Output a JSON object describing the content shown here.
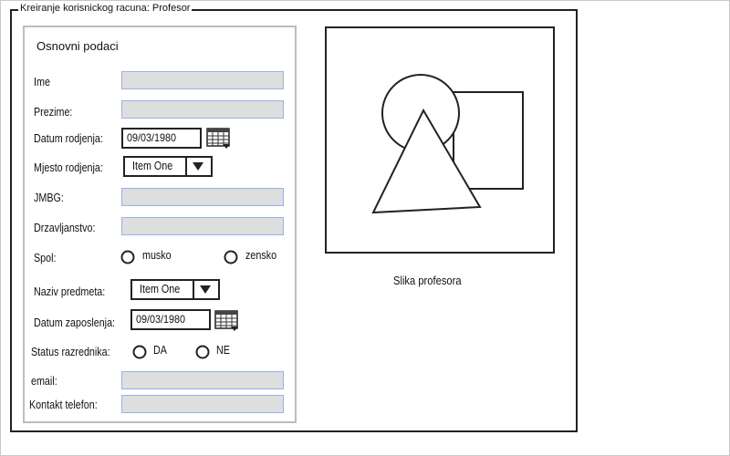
{
  "window": {
    "title": "Kreiranje korisnickog racuna: Profesor"
  },
  "panel": {
    "title": "Osnovni podaci"
  },
  "fields": {
    "ime": {
      "label": "Ime",
      "value": ""
    },
    "prezime": {
      "label": "Prezime:",
      "value": ""
    },
    "datum_rodjenja": {
      "label": "Datum rodjenja:",
      "value": "09/03/1980"
    },
    "mjesto_rodjenja": {
      "label": "Mjesto rodjenja:",
      "selected": "Item One"
    },
    "jmbg": {
      "label": "JMBG:",
      "value": ""
    },
    "drzavljanstvo": {
      "label": "Drzavljanstvo:",
      "value": ""
    },
    "spol": {
      "label": "Spol:",
      "options": [
        "musko",
        "zensko"
      ],
      "selected": null
    },
    "naziv_predmeta": {
      "label": "Naziv predmeta:",
      "selected": "Item One"
    },
    "datum_zaposlenja": {
      "label": "Datum zaposlenja:",
      "value": "09/03/1980"
    },
    "status_razrednika": {
      "label": "Status razrednika:",
      "options": [
        "DA",
        "NE"
      ],
      "selected": null
    },
    "email": {
      "label": "email:",
      "value": ""
    },
    "kontakt_telefon": {
      "label": "Kontakt telefon:",
      "value": ""
    }
  },
  "photo": {
    "caption": "Slika profesora"
  },
  "icons": {
    "calendar": "calendar-icon",
    "dropdown": "chevron-down-icon",
    "radio": "radio-unchecked-icon",
    "placeholder": "image-placeholder-icon"
  },
  "colors": {
    "field_bg": "#dedede",
    "field_border": "#9ab0e8",
    "panel_border": "#bdbdbd"
  }
}
